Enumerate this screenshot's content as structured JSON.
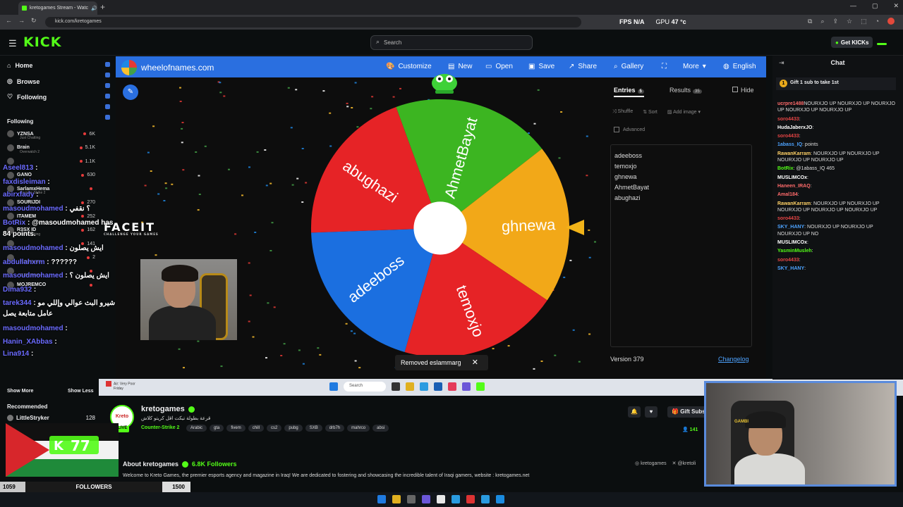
{
  "browser": {
    "tab_title": "kretogames Stream - Watc",
    "url": "kick.com/kretogames",
    "fps_label": "FPS",
    "fps_value": "N/A",
    "gpu_label": "GPU",
    "gpu_value": "47 °c"
  },
  "kick": {
    "logo": "KICK",
    "search_placeholder": "Search",
    "get_kicks": "Get KICKs",
    "brand_color": "#53fc18"
  },
  "sidebar": {
    "nav": [
      {
        "label": "Home",
        "icon": "home-icon"
      },
      {
        "label": "Browse",
        "icon": "compass-icon"
      },
      {
        "label": "Following",
        "icon": "heart-icon"
      }
    ],
    "following_header": "Following",
    "following": [
      {
        "name": "YZNSA",
        "sub": "Just Chatting",
        "count": "6K"
      },
      {
        "name": "Brain",
        "sub": "Overwatch 2",
        "count": "5.1K"
      },
      {
        "name": "",
        "sub": "",
        "count": "1.1K"
      },
      {
        "name": "GANO",
        "sub": "",
        "count": "630"
      },
      {
        "name": "SarlamxHema",
        "sub": "Counter-Strike 2",
        "count": ""
      },
      {
        "name": "SOURIJDI",
        "sub": "",
        "count": "270"
      },
      {
        "name": "ITAMEM",
        "sub": "",
        "count": "252"
      },
      {
        "name": "R3SX ID",
        "sub": "Just Chatting",
        "count": "162"
      },
      {
        "name": "",
        "sub": "",
        "count": "141"
      },
      {
        "name": "",
        "sub": "PUBG Mobile",
        "count": "2"
      },
      {
        "name": "",
        "sub": "PUBG Mobile",
        "count": ""
      },
      {
        "name": "MOJREMCO",
        "sub": "",
        "count": ""
      }
    ],
    "show_more": "Show More",
    "show_less": "Show Less",
    "recommended_header": "Recommended",
    "recommended": [
      {
        "name": "LittleStryker",
        "count": "128"
      }
    ]
  },
  "overlay_chat": [
    {
      "user": "Aseel813",
      "msg": ":"
    },
    {
      "user": "faxdisleiman",
      "msg": ":"
    },
    {
      "user": "abirxfady",
      "msg": ":"
    },
    {
      "user": "masoudmohamed",
      "msg": ": ؟ نقفي"
    },
    {
      "user": "BotRix",
      "msg": ": @masoudmohamed has"
    },
    {
      "user": "",
      "msg": "84 points."
    },
    {
      "user": "masoudmohamed",
      "msg": ": ايش يصلون"
    },
    {
      "user": "abdullahxrm",
      "msg": ": ??????"
    },
    {
      "user": "masoudmohamed",
      "msg": ": ايش يصلون ؟"
    },
    {
      "user": "Dima932",
      "msg": ":"
    },
    {
      "user": "tarek344",
      "msg": ": شيرو البث عوالي وإللي مو"
    },
    {
      "user": "",
      "msg": "عامل متابعة يصل"
    },
    {
      "user": "masoudmohamed",
      "msg": ":"
    },
    {
      "user": "Hanin_XAbbas",
      "msg": ":"
    },
    {
      "user": "Lina914",
      "msg": ":"
    }
  ],
  "wheel": {
    "site": "wheelofnames.com",
    "menu": [
      "Customize",
      "New",
      "Open",
      "Save",
      "Share",
      "Gallery",
      "More",
      "English"
    ],
    "segments": [
      {
        "name": "AhmetBayat",
        "color": "#3cb521"
      },
      {
        "name": "ghnewa",
        "color": "#f2a818"
      },
      {
        "name": "temoxjo",
        "color": "#e62326"
      },
      {
        "name": "adeeboss",
        "color": "#1b6fe0"
      },
      {
        "name": "abughazi",
        "color": "#e62326"
      }
    ],
    "toast": "Removed eslammarg",
    "entries_tab": "Entries",
    "entries_count": "5",
    "results_tab": "Results",
    "results_count": "35",
    "hide": "Hide",
    "shuffle": "Shuffle",
    "sort": "Sort",
    "add_image": "Add image",
    "advanced": "Advanced",
    "entries": [
      "adeeboss",
      "temoxjo",
      "ghnewa",
      "AhmetBayat",
      "abughazi"
    ],
    "version": "Version 379",
    "changelog": "Changelog"
  },
  "faceit": {
    "title": "FACEIT",
    "tagline": "CHALLENGE YOUR GAMES"
  },
  "stream_taskbar": {
    "weather_top": "Air: Very Poor",
    "weather_bottom": "Friday",
    "search": "Search"
  },
  "chat": {
    "title": "Chat",
    "gift_banner": "Gift 1 sub to take 1st",
    "messages": [
      {
        "user": "ucrpre1488",
        "color": "#ff6b6b",
        "msg": "NOURXJO UP NOURXJO UP NOURXJO UP NOURXJO UP NOURXJO UP"
      },
      {
        "user": "soro4433",
        "color": "#e64545",
        "msg": ":"
      },
      {
        "user": "HudaJaberxJO",
        "color": "#ffffff",
        "msg": ":"
      },
      {
        "user": "soro4433",
        "color": "#e64545",
        "msg": ":"
      },
      {
        "user": "1abass_IQ",
        "color": "#4da3ff",
        "msg": ": points"
      },
      {
        "user": "RawanKarram",
        "color": "#ffd166",
        "msg": ": NOURXJO UP NOURXJO UP NOURXJO UP NOURXJO UP"
      },
      {
        "user": "BotRix",
        "color": "#53fc18",
        "msg": ": @1abass_IQ 465"
      },
      {
        "user": "MUSLIMCOx",
        "color": "#ffffff",
        "msg": ":"
      },
      {
        "user": "Haneen_IRAQ",
        "color": "#ff6b6b",
        "msg": ":"
      },
      {
        "user": "Amal184",
        "color": "#ff6b6b",
        "msg": ":"
      },
      {
        "user": "RawanKarram",
        "color": "#ffd166",
        "msg": ": NOURXJO UP NOURXJO UP NOURXJO UP NOURXJO UP NOURXJO UP"
      },
      {
        "user": "soro4433",
        "color": "#e64545",
        "msg": ":"
      },
      {
        "user": "SKY_HANY",
        "color": "#4da3ff",
        "msg": ": NOURXJO UP NOURXJO UP NOURXJO UP NO"
      },
      {
        "user": "MUSLIMCOx",
        "color": "#ffffff",
        "msg": ":"
      },
      {
        "user": "YasminMusleh",
        "color": "#53fc18",
        "msg": ":"
      },
      {
        "user": "soro4433",
        "color": "#e64545",
        "msg": ":"
      },
      {
        "user": "SKY_HANY",
        "color": "#4da3ff",
        "msg": ":"
      }
    ]
  },
  "channel": {
    "name": "kretogames",
    "live": "LIVE",
    "subtitle": "قرعة بطولة تيكت اقل كريتو كلاش",
    "category": "Counter-Strike 2",
    "tags": [
      "Arabic",
      "gta",
      "fivem",
      "chill",
      "cs2",
      "pubg",
      "SXB",
      "drb7h",
      "mahrco",
      "absi"
    ],
    "gift_subs": "Gift Subs",
    "viewers": "141",
    "about": "About kretogames",
    "followers": "6.8K Followers",
    "description": "Welcome to Kreto Games, the premier esports agency and magazine in Iraq! We are dedicated to fostering and showcasing the incredible talent of Iraqi gamers, website : kretogames.net",
    "socials": [
      "kretogames",
      "@kretoli"
    ]
  },
  "followers_goal": {
    "current": "1059",
    "label": "FOLLOWERS",
    "goal": "1500",
    "flag_count": "77"
  }
}
